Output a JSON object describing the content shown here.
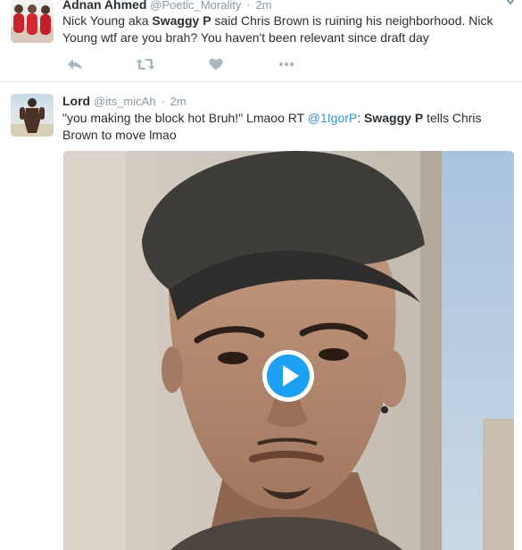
{
  "tweets": [
    {
      "author_name": "Adnan Ahmed",
      "author_handle": "@Poetic_Morality",
      "time": "2m",
      "text_1": "Nick Young aka ",
      "bold_1": "Swaggy P",
      "text_2": " said Chris Brown is ruining his neighborhood. Nick Young wtf are you brah? You haven't been relevant since draft day",
      "actions": [
        "reply-icon",
        "retweet-icon",
        "like-icon",
        "more-icon"
      ]
    },
    {
      "author_name": "Lord",
      "author_handle": "@its_micAh",
      "time": "2m",
      "text_1": "\"you making the block hot Bruh!\" Lmaoo RT ",
      "mention": "@1IgorP",
      "text_2": ": ",
      "bold_1": "Swaggy P",
      "text_3": " tells Chris Brown to move lmao",
      "media": {
        "type": "video",
        "play_icon": "play-icon"
      }
    }
  ],
  "colors": {
    "accent": "#3b94d9",
    "muted": "#8899a6",
    "action_icon": "#aab8c2",
    "text": "#292f33",
    "divider": "#e1e8ed"
  }
}
